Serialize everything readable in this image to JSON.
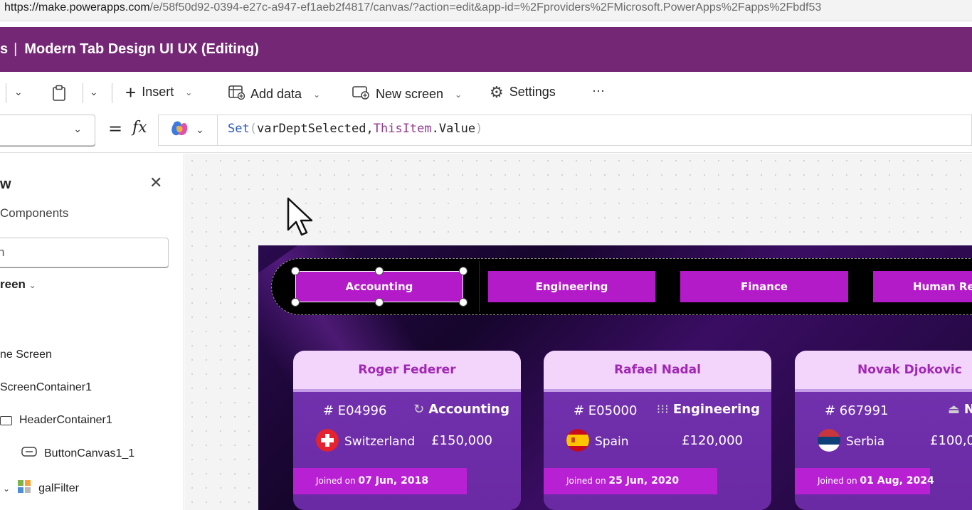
{
  "browser": {
    "url_host": "https://make.powerapps.com",
    "url_path": "/e/58f50d92-0394-e27c-a947-ef1aeb2f4817/canvas/?action=edit&app-id=%2Fproviders%2FMicrosoft.PowerApps%2Fapps%2Fbdf53"
  },
  "titlebar": {
    "prefix": "s",
    "title": "Modern Tab Design UI UX (Editing)"
  },
  "commandbar": {
    "insert": "Insert",
    "add_data": "Add data",
    "new_screen": "New screen",
    "settings": "Settings",
    "more": "···"
  },
  "formulabar": {
    "equals": "=",
    "fx": "fx",
    "fn": "Set",
    "arg1": "varDeptSelected",
    "arg2_obj": "ThisItem",
    "arg2_prop": "Value"
  },
  "treeview": {
    "title": "w",
    "components_tab": "Components",
    "search_value": "h",
    "screen_picker": "reen",
    "items": [
      {
        "label": "ne Screen"
      },
      {
        "label": "ScreenContainer1"
      },
      {
        "label": "HeaderContainer1"
      },
      {
        "label": "ButtonCanvas1_1"
      },
      {
        "label": "galFilter"
      }
    ]
  },
  "app": {
    "tabs": [
      "Accounting",
      "Engineering",
      "Finance",
      "Human Reso"
    ],
    "joined_prefix": "Joined on",
    "cards": [
      {
        "name": "Roger Federer",
        "id": "# E04996",
        "dept": "Accounting",
        "dept_icon": "↻",
        "country": "Switzerland",
        "salary": "£150,000",
        "joined": "07 Jun, 2018",
        "flag": "switzerland"
      },
      {
        "name": "Rafael Nadal",
        "id": "# E05000",
        "dept": "Engineering",
        "dept_icon": "⁝⁝⁝",
        "country": "Spain",
        "salary": "£120,000",
        "joined": "25 Jun, 2020",
        "flag": "spain"
      },
      {
        "name": "Novak Djokovic",
        "id": "# 667991",
        "dept": "N",
        "dept_icon": "⏏",
        "country": "Serbia",
        "salary": "£100,0",
        "joined": "01 Aug, 2024",
        "flag": "serbia"
      }
    ]
  },
  "colors": {
    "titlebar": "#742774",
    "tab": "#b41bc8",
    "card_header": "#f3d5fb",
    "card_name": "#a026b5"
  }
}
